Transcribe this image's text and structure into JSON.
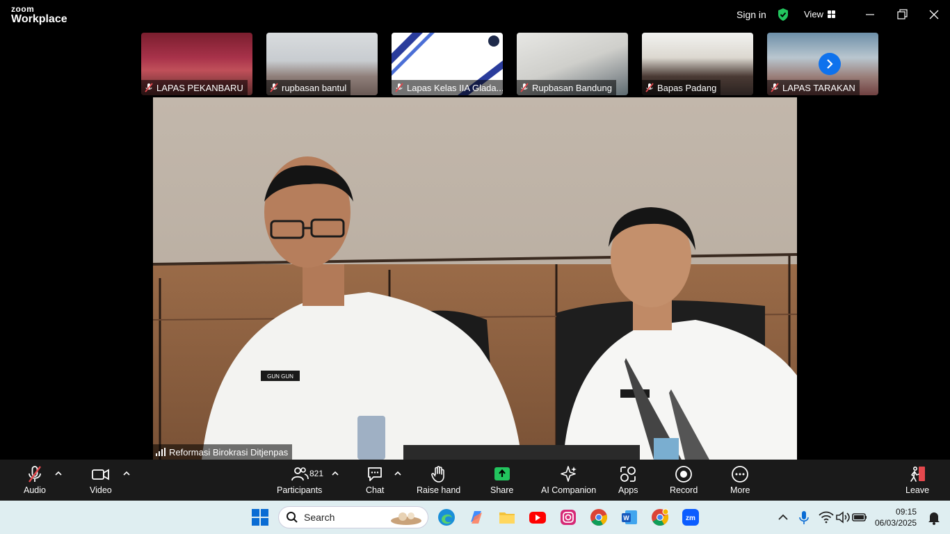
{
  "titlebar": {
    "brand_top": "zoom",
    "brand_bottom": "Workplace",
    "signin_label": "Sign in",
    "view_label": "View",
    "shield_color": "#22c55e"
  },
  "gallery": {
    "tiles": [
      {
        "name": "LAPAS PEKANBARU"
      },
      {
        "name": "rupbasan bantul"
      },
      {
        "name": "Lapas Kelas IIA Glada..."
      },
      {
        "name": "Rupbasan Bandung"
      },
      {
        "name": "Bapas Padang"
      },
      {
        "name": "LAPAS TARAKAN"
      }
    ],
    "next_icon": "chevron-right-icon",
    "accent": "#0e72ed"
  },
  "main_video": {
    "speaker_name": "Reformasi Birokrasi Ditjenpas",
    "badge_left": "GUN GUN"
  },
  "toolbar": {
    "audio_label": "Audio",
    "video_label": "Video",
    "participants_label": "Participants",
    "participants_count": "821",
    "chat_label": "Chat",
    "raise_hand_label": "Raise hand",
    "share_label": "Share",
    "ai_label": "AI Companion",
    "apps_label": "Apps",
    "record_label": "Record",
    "more_label": "More",
    "leave_label": "Leave",
    "share_color": "#22c55e",
    "muted_color": "#e5484d"
  },
  "taskbar": {
    "search_placeholder": "Search",
    "time": "09:15",
    "date": "06/03/2025"
  }
}
